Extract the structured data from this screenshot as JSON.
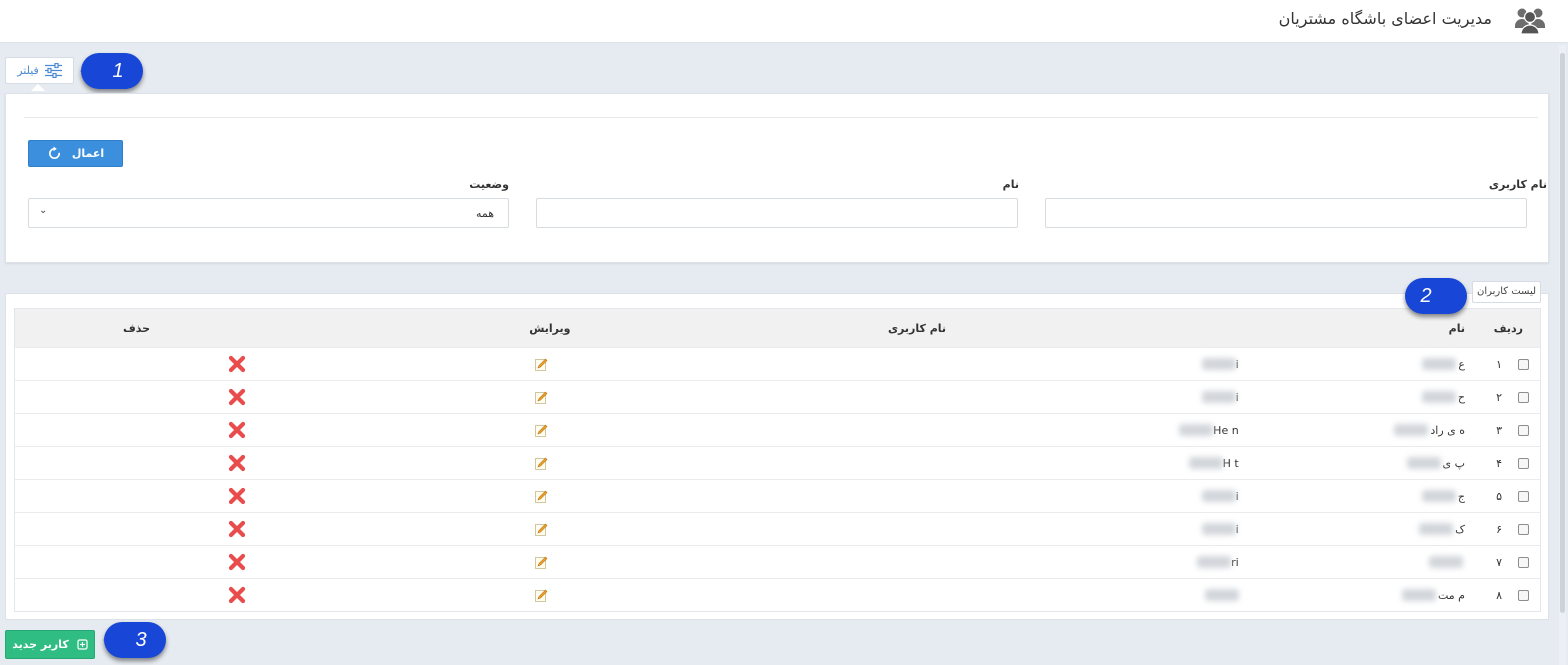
{
  "header": {
    "title": "مدیریت اعضای باشگاه مشتریان",
    "icon": "users-icon"
  },
  "filter": {
    "tab_label": "فیلتر",
    "apply_label": "اعمال",
    "fields": {
      "username_label": "نام کاربری",
      "name_label": "نام",
      "status_label": "وضعیت",
      "status_value": "همه"
    }
  },
  "list": {
    "tab_label": "لیست کاربران",
    "columns": {
      "row": "ردیف",
      "name": "نام",
      "username": "نام کاربری",
      "edit": "ویرایش",
      "delete": "حذف"
    },
    "rows": [
      {
        "index": "۱",
        "name_visible": "ع",
        "username_visible": "i"
      },
      {
        "index": "۲",
        "name_visible": "ح",
        "username_visible": "i"
      },
      {
        "index": "۳",
        "name_visible": "ه  ی راد",
        "username_visible": "He  n"
      },
      {
        "index": "۴",
        "name_visible": "پ  ی",
        "username_visible": "H  t"
      },
      {
        "index": "۵",
        "name_visible": "ج",
        "username_visible": "i"
      },
      {
        "index": "۶",
        "name_visible": "ک",
        "username_visible": "i"
      },
      {
        "index": "۷",
        "name_visible": "",
        "username_visible": "ri"
      },
      {
        "index": "۸",
        "name_visible": "م  مت",
        "username_visible": ""
      }
    ]
  },
  "footer": {
    "new_user_label": "کاربر جدید"
  },
  "callouts": [
    "1",
    "2",
    "3"
  ],
  "colors": {
    "primary_blue": "#3c8fdc",
    "success_green": "#2fbd83",
    "delete_red": "#e84c4c",
    "callout_blue": "#1846d6"
  }
}
